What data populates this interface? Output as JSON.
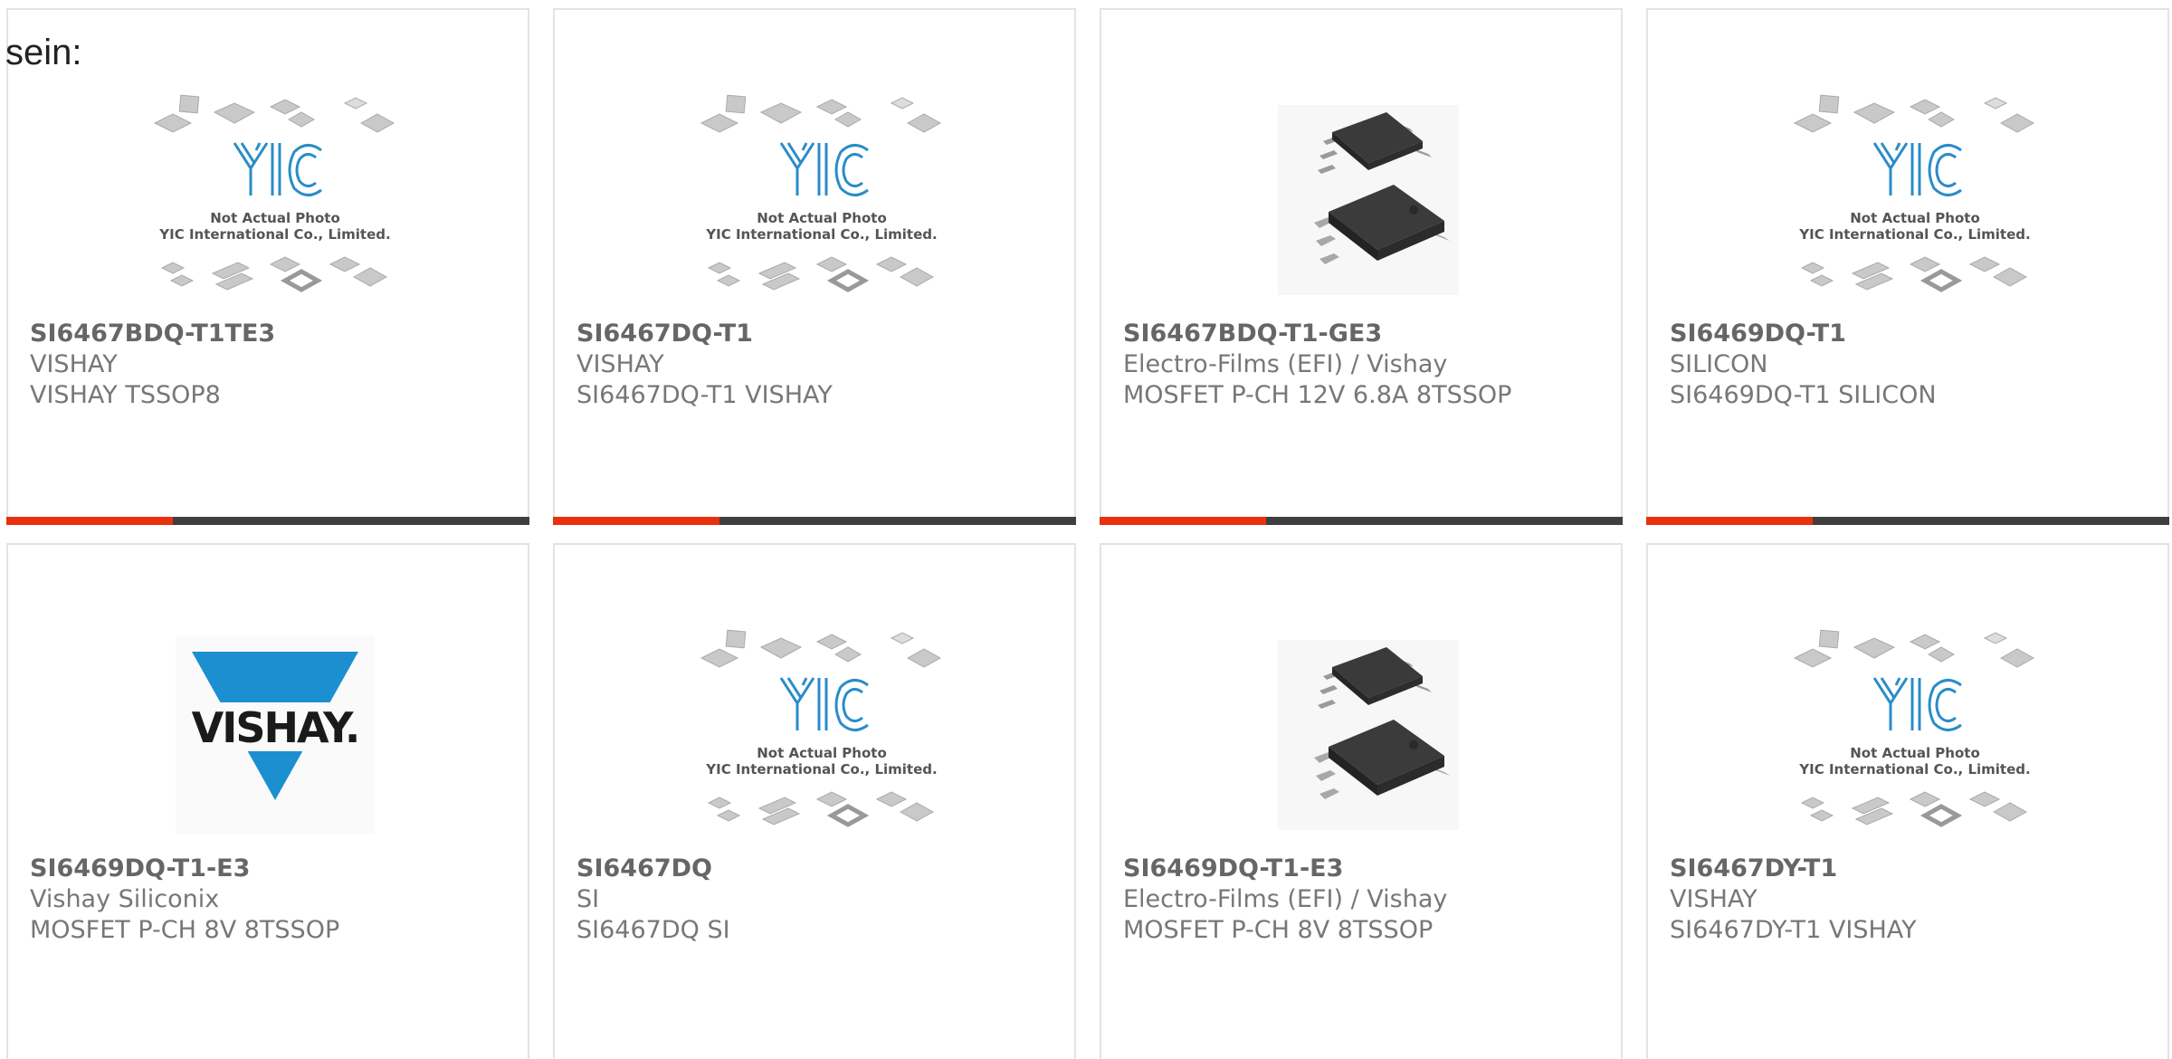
{
  "heading": "sein:",
  "colors": {
    "accent": "#e8310d",
    "bar": "#3f3f3f",
    "vishay_blue": "#1c8fd0"
  },
  "placeholder_image": {
    "line1": "Not Actual Photo",
    "line2": "YIC International Co., Limited.",
    "logo": "YIC"
  },
  "vishay_logo": {
    "text": "VISHAY."
  },
  "products": [
    {
      "part": "SI6467BDQ-T1TE3",
      "maker": "VISHAY",
      "desc": "VISHAY TSSOP8",
      "image": "yic-placeholder"
    },
    {
      "part": "SI6467DQ-T1",
      "maker": "VISHAY",
      "desc": "SI6467DQ-T1 VISHAY",
      "image": "yic-placeholder"
    },
    {
      "part": "SI6467BDQ-T1-GE3",
      "maker": "Electro-Films (EFI) / Vishay",
      "desc": "MOSFET P-CH 12V 6.8A 8TSSOP",
      "image": "tssop-chip"
    },
    {
      "part": "SI6469DQ-T1",
      "maker": "SILICON",
      "desc": "SI6469DQ-T1 SILICON",
      "image": "yic-placeholder"
    },
    {
      "part": "SI6469DQ-T1-E3",
      "maker": "Vishay Siliconix",
      "desc": "MOSFET P-CH 8V 8TSSOP",
      "image": "vishay-logo"
    },
    {
      "part": "SI6467DQ",
      "maker": "SI",
      "desc": "SI6467DQ SI",
      "image": "yic-placeholder"
    },
    {
      "part": "SI6469DQ-T1-E3",
      "maker": "Electro-Films (EFI) / Vishay",
      "desc": "MOSFET P-CH 8V 8TSSOP",
      "image": "tssop-chip"
    },
    {
      "part": "SI6467DY-T1",
      "maker": "VISHAY",
      "desc": "SI6467DY-T1 VISHAY",
      "image": "yic-placeholder"
    }
  ]
}
